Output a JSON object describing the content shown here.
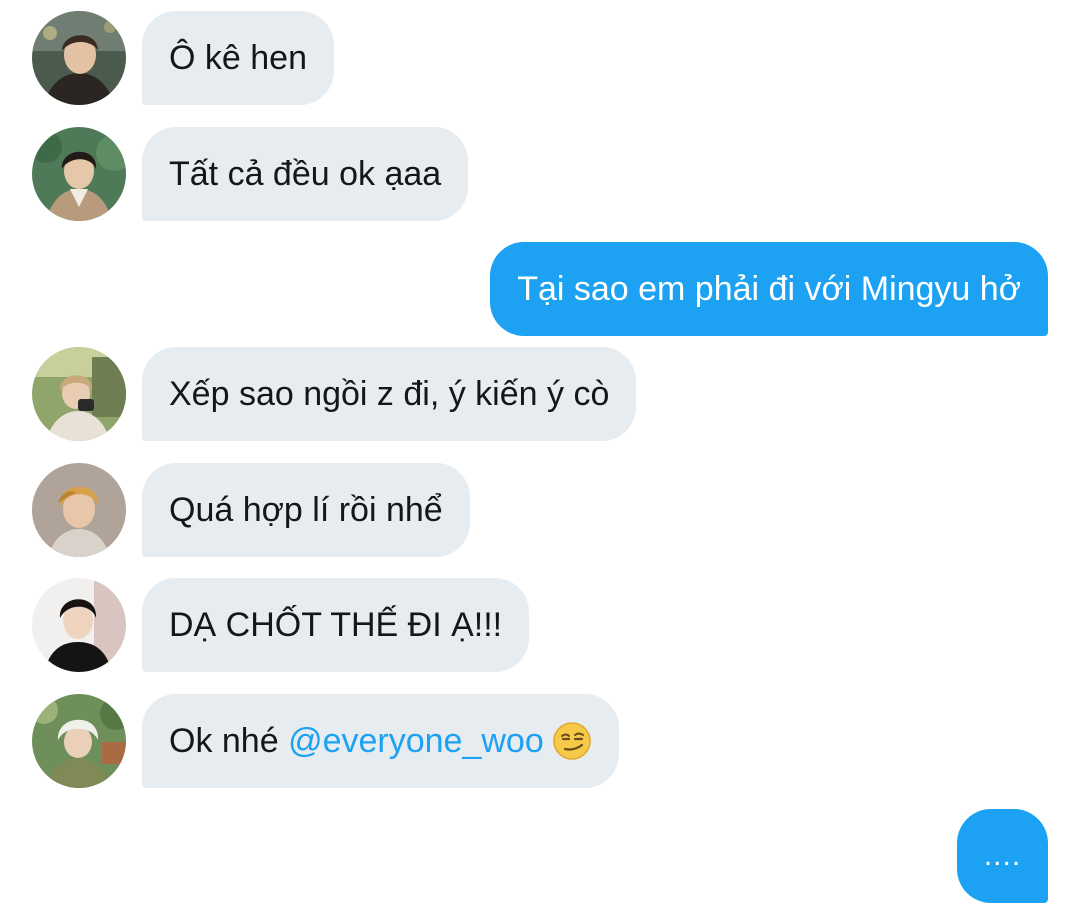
{
  "conversation": {
    "messages": [
      {
        "side": "incoming",
        "text": "Ô kê hen"
      },
      {
        "side": "incoming",
        "text": "Tất cả đều ok ạaa"
      },
      {
        "side": "outgoing",
        "text": "Tại sao em phải đi với Mingyu hở"
      },
      {
        "side": "incoming",
        "text": "Xếp sao ngồi z đi, ý kiến ý cò"
      },
      {
        "side": "incoming",
        "text": "Quá hợp lí rồi nhể"
      },
      {
        "side": "incoming",
        "text": "DẠ CHỐT THẾ ĐI Ạ!!!"
      },
      {
        "side": "incoming",
        "text_prefix": "Ok nhé ",
        "mention": "@everyone_woo",
        "emoji": "smirking-face-emoji"
      }
    ],
    "typing_indicator": "....",
    "colors": {
      "outgoing_bubble": "#1da1f2",
      "incoming_bubble": "#e6ecf0",
      "mention": "#1da1f2"
    }
  }
}
